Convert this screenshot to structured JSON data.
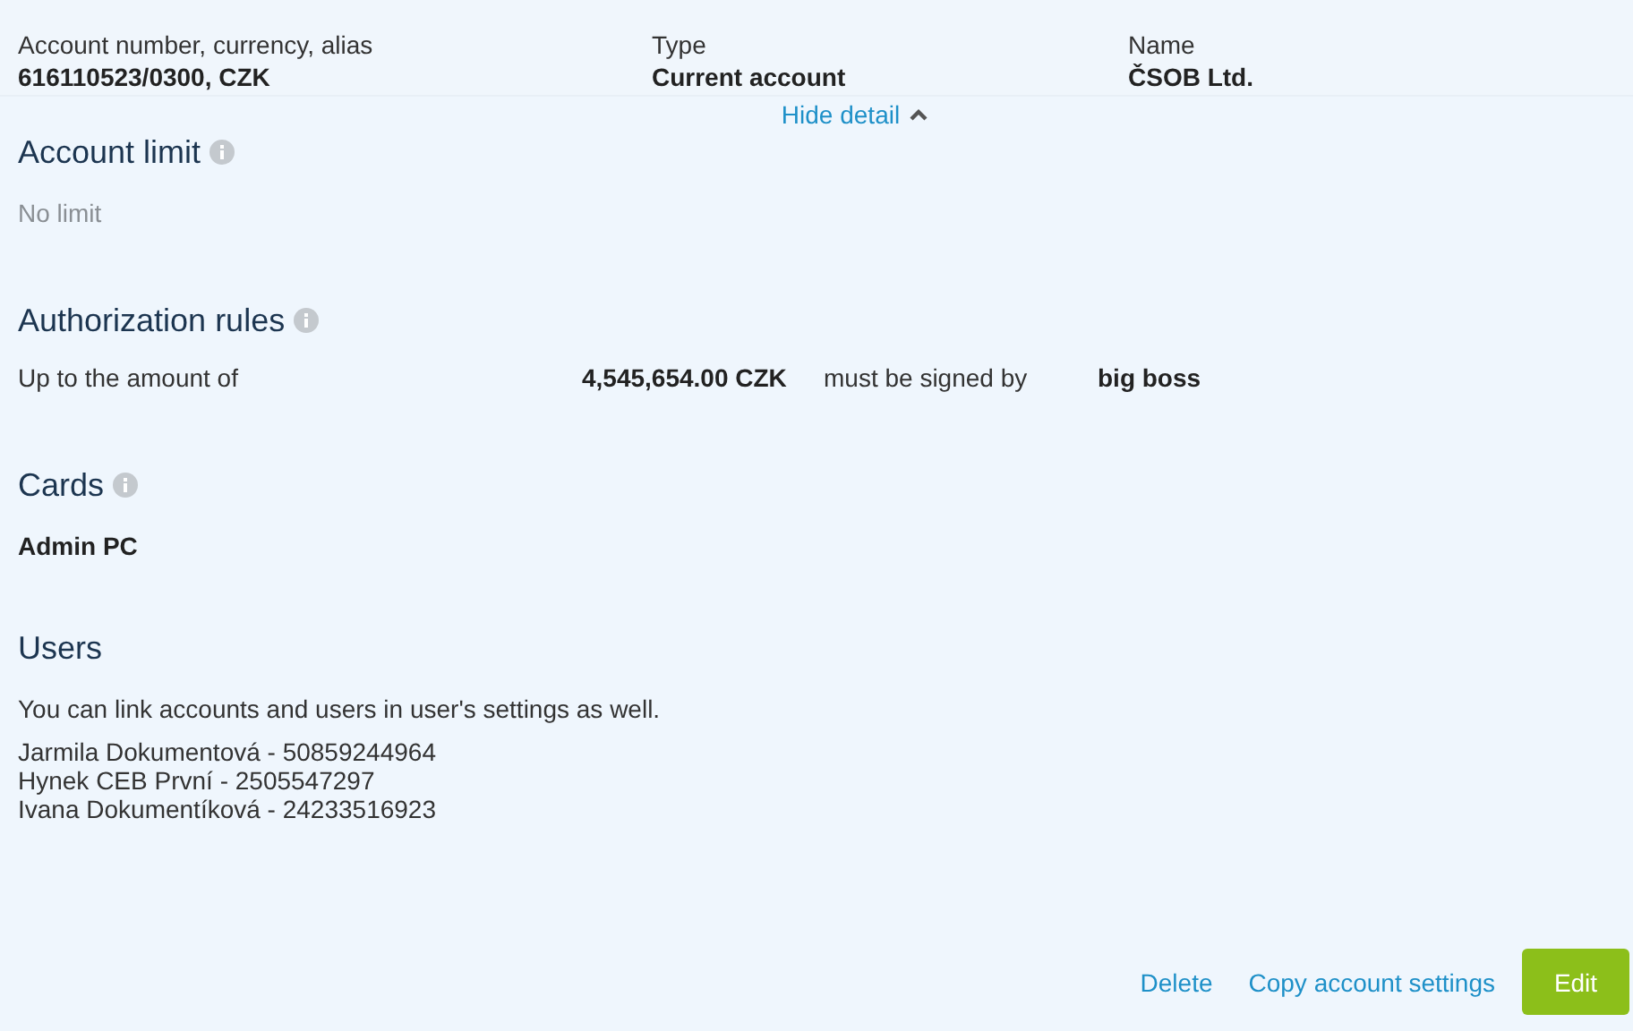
{
  "summary": [
    {
      "label": "Account number, currency, alias",
      "value": "616110523/0300, CZK"
    },
    {
      "label": "Type",
      "value": "Current account"
    },
    {
      "label": "Name",
      "value": "ČSOB Ltd."
    }
  ],
  "toggle": {
    "label": "Hide detail",
    "expanded": true
  },
  "account_limit": {
    "title": "Account limit",
    "value": "No limit"
  },
  "authorization_rules": {
    "title": "Authorization rules",
    "rules": [
      {
        "prefix": "Up to the amount of",
        "amount": "4,545,654.00 CZK",
        "middle": "must be signed by",
        "signer": "big boss"
      }
    ]
  },
  "cards": {
    "title": "Cards",
    "items": [
      "Admin PC"
    ]
  },
  "users": {
    "title": "Users",
    "note": "You can link accounts and users in user's settings as well.",
    "items": [
      "Jarmila Dokumentová - 50859244964",
      "Hynek CEB První - 2505547297",
      "Ivana Dokumentíková - 24233516923"
    ]
  },
  "actions": [
    {
      "label": "Delete",
      "kind": "link"
    },
    {
      "label": "Copy account settings",
      "kind": "link"
    },
    {
      "label": "Edit",
      "kind": "primary"
    }
  ]
}
